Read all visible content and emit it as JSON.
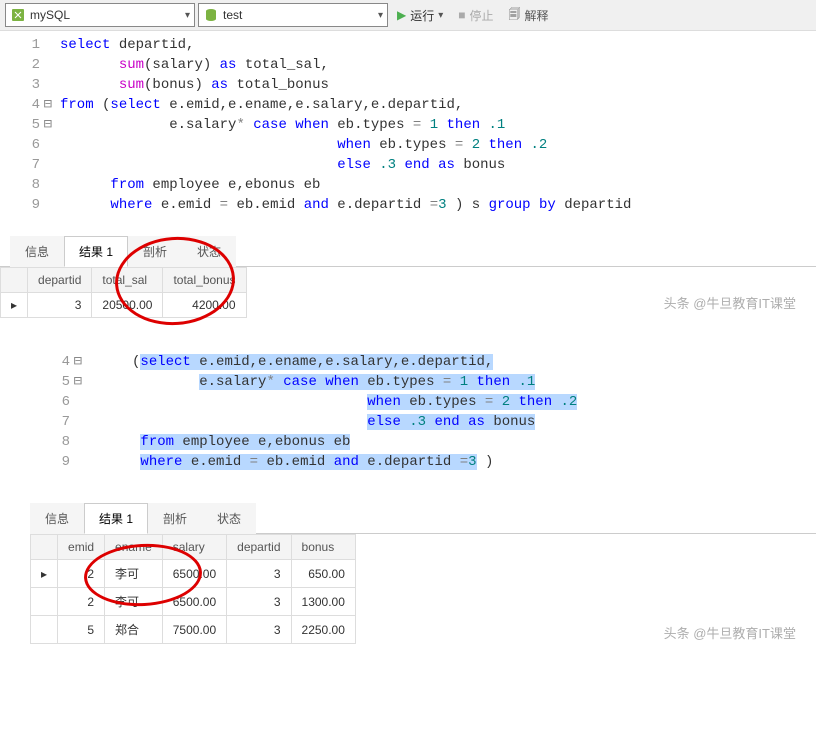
{
  "toolbar": {
    "connection": "mySQL",
    "database": "test",
    "run_label": "运行",
    "stop_label": "停止",
    "explain_label": "解释"
  },
  "editor1": {
    "lines": [
      {
        "n": 1,
        "html": "<span class='kw'>select</span> departid,"
      },
      {
        "n": 2,
        "html": "       <span class='fn'>sum</span>(salary) <span class='kw'>as</span> total_sal,"
      },
      {
        "n": 3,
        "html": "       <span class='fn'>sum</span>(bonus) <span class='kw'>as</span> total_bonus"
      },
      {
        "n": 4,
        "fold": "⊟",
        "html": "<span class='kw'>from</span> (<span class='kw'>select</span> e.emid,e.ename,e.salary,e.departid,"
      },
      {
        "n": 5,
        "fold": "⊟",
        "html": "             e.salary<span class='op'>*</span> <span class='kw'>case</span> <span class='kw'>when</span> eb.types <span class='op'>=</span> <span class='num'>1</span> <span class='kw'>then</span> <span class='num'>.1</span>"
      },
      {
        "n": 6,
        "html": "                                 <span class='kw'>when</span> eb.types <span class='op'>=</span> <span class='num'>2</span> <span class='kw'>then</span> <span class='num'>.2</span>"
      },
      {
        "n": 7,
        "html": "                                 <span class='kw'>else</span> <span class='num'>.3</span> <span class='kw'>end</span> <span class='kw'>as</span> bonus"
      },
      {
        "n": 8,
        "html": "      <span class='kw'>from</span> employee e,ebonus eb"
      },
      {
        "n": 9,
        "html": "      <span class='kw'>where</span> e.emid <span class='op'>=</span> eb.emid <span class='kw'>and</span> e.departid <span class='op'>=</span><span class='num'>3</span> ) s <span class='kw'>group</span> <span class='kw'>by</span> departid"
      }
    ]
  },
  "tabs": {
    "info": "信息",
    "result1": "结果 1",
    "profile": "剖析",
    "status": "状态"
  },
  "result1": {
    "headers": [
      "departid",
      "total_sal",
      "total_bonus"
    ],
    "rows": [
      {
        "departid": "3",
        "total_sal": "20500.00",
        "total_bonus": "4200.00"
      }
    ]
  },
  "editor2": {
    "lines": [
      {
        "n": 4,
        "fold": "⊟",
        "html": "     (<span class='hl'><span class='kw'>select</span> e.emid,e.ename,e.salary,e.departid,</span>"
      },
      {
        "n": 5,
        "fold": "⊟",
        "html": "             <span class='hl'>e.salary<span class='op'>*</span> <span class='kw'>case</span> <span class='kw'>when</span> eb.types <span class='op'>=</span> <span class='num'>1</span> <span class='kw'>then</span> <span class='num'>.1</span></span>"
      },
      {
        "n": 6,
        "html": "                                 <span class='hl'><span class='kw'>when</span> eb.types <span class='op'>=</span> <span class='num'>2</span> <span class='kw'>then</span> <span class='num'>.2</span></span>"
      },
      {
        "n": 7,
        "html": "                                 <span class='hl'><span class='kw'>else</span> <span class='num'>.3</span> <span class='kw'>end</span> <span class='kw'>as</span> bonus</span>"
      },
      {
        "n": 8,
        "html": "      <span class='hl'><span class='kw'>from</span> employee e,ebonus eb</span>"
      },
      {
        "n": 9,
        "html": "      <span class='hl'><span class='kw'>where</span> e.emid <span class='op'>=</span> eb.emid <span class='kw'>and</span> e.departid <span class='op'>=</span><span class='num'>3</span></span> )"
      }
    ]
  },
  "result2": {
    "headers": [
      "emid",
      "ename",
      "salary",
      "departid",
      "bonus"
    ],
    "rows": [
      {
        "emid": "2",
        "ename": "李可",
        "salary": "6500.00",
        "departid": "3",
        "bonus": "650.00"
      },
      {
        "emid": "2",
        "ename": "李可",
        "salary": "6500.00",
        "departid": "3",
        "bonus": "1300.00"
      },
      {
        "emid": "5",
        "ename": "郑合",
        "salary": "7500.00",
        "departid": "3",
        "bonus": "2250.00"
      }
    ]
  },
  "watermark": "头条 @牛旦教育IT课堂"
}
